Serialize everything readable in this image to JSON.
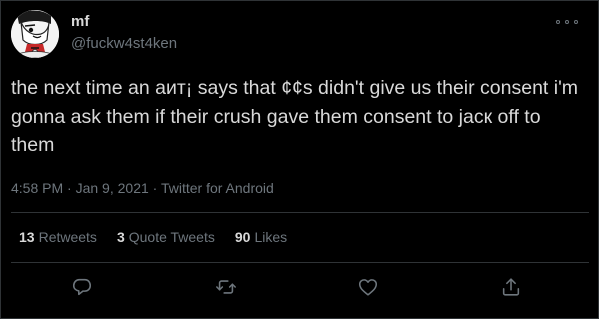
{
  "author": {
    "display_name": "mf",
    "handle": "@fuckw4st4ken",
    "avatar_icon": "cartoon-avatar"
  },
  "tweet": {
    "text": "the next time an аит¡ says that ¢¢s didn't give us their consent i'm gonna ask them if their crush gave them consent to jacк off to them",
    "time": "4:58 PM",
    "separator": " · ",
    "date": "Jan 9, 2021",
    "source": "Twitter for Android"
  },
  "stats": {
    "retweets_count": "13",
    "retweets_label": "Retweets",
    "quote_tweets_count": "3",
    "quote_tweets_label": "Quote Tweets",
    "likes_count": "90",
    "likes_label": "Likes"
  },
  "actions": {
    "reply_icon": "reply-icon",
    "retweet_icon": "retweet-icon",
    "like_icon": "like-icon",
    "share_icon": "share-icon"
  },
  "colors": {
    "background": "#000000",
    "text": "#d9d9d9",
    "secondary": "#6e767d",
    "border": "#2f3336"
  }
}
